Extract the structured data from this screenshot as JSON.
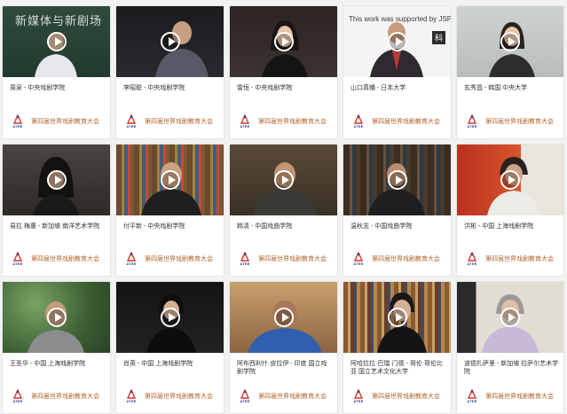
{
  "organization_label": "第四届世界戏剧教育大会",
  "logo_text": "ATEE",
  "colors": {
    "accent": "#b0642c",
    "logo": "#1e3d8f",
    "logo_red": "#d9342b"
  },
  "cards": [
    {
      "title": "周泉 - 中央戏剧学院",
      "thumb": "chalkboard"
    },
    {
      "title": "李昭聪 - 中央戏剧学院",
      "thumb": "dark-studio"
    },
    {
      "title": "雷恒 - 中央戏剧学院",
      "thumb": "dark-room"
    },
    {
      "title": "山口真幡 - 日本大学",
      "thumb": "slide",
      "overlay_text": "This work was supported by JSPS",
      "badge_text": "科"
    },
    {
      "title": "玄秀昌 - 韩国 中央大学",
      "thumb": "office"
    },
    {
      "title": "易拉 梅惠 - 新加坡 南洋艺术学院",
      "thumb": "dim-room"
    },
    {
      "title": "付平新 - 中央戏剧学院",
      "thumb": "bookshelf"
    },
    {
      "title": "韩清 - 中国戏曲学院",
      "thumb": "living-room"
    },
    {
      "title": "温秋志 - 中国戏曲学院",
      "thumb": "bookshelf-dark"
    },
    {
      "title": "洪彬 - 中国 上海戏剧学院",
      "thumb": "red-wall"
    },
    {
      "title": "王圣华 - 中国 上海戏剧学院",
      "thumb": "trees"
    },
    {
      "title": "肖英 - 中国 上海戏剧学院",
      "thumb": "black"
    },
    {
      "title": "阿布西利什·皮拉伊 - 印度 国立戏剧学院",
      "thumb": "blue-shirt"
    },
    {
      "title": "阿哈拉拉·巴瑞·门德 - 哥伦 哥伦比亚 国立艺术文化大学",
      "thumb": "library"
    },
    {
      "title": "波德扎萨里 - 新加坡 拉萨尔艺术学院",
      "thumb": "light-room"
    }
  ]
}
